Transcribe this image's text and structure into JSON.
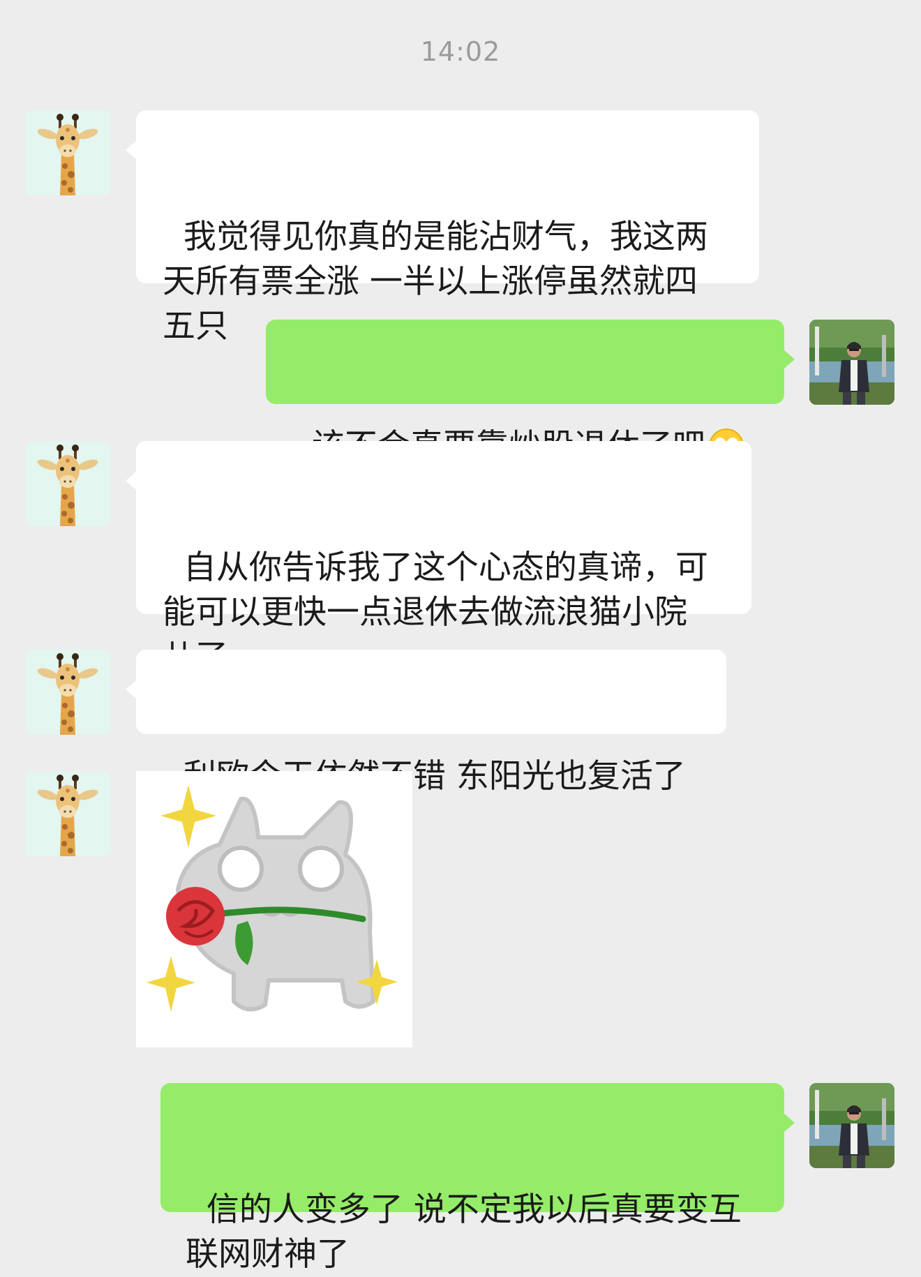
{
  "chat": {
    "timestamp": "14:02",
    "messages": [
      {
        "sender": "friend",
        "text": "我觉得见你真的是能沾财气，我这两\n天所有票全涨 一半以上涨停虽然就四\n五只"
      },
      {
        "sender": "me",
        "text": "该不会真要靠炒股退休了吧",
        "emoji": "flushed-face-emoji"
      },
      {
        "sender": "friend",
        "text": "自从你告诉我了这个心态的真谛，可\n能可以更快一点退休去做流浪猫小院\n儿了"
      },
      {
        "sender": "friend",
        "text": "利欧今天依然不错 东阳光也复活了"
      },
      {
        "sender": "friend",
        "sticker": "gray-cat-holding-rose-sticker"
      },
      {
        "sender": "me",
        "text": "信的人变多了 说不定我以后真要变互\n联网财神了"
      }
    ]
  },
  "colors": {
    "background": "#ededed",
    "incoming_bubble": "#ffffff",
    "outgoing_bubble": "#95ec69",
    "timestamp_text": "#9b9b9b"
  },
  "icons": {
    "friend_avatar": "giraffe-avatar-icon",
    "my_avatar": "person-photo-avatar-icon"
  }
}
